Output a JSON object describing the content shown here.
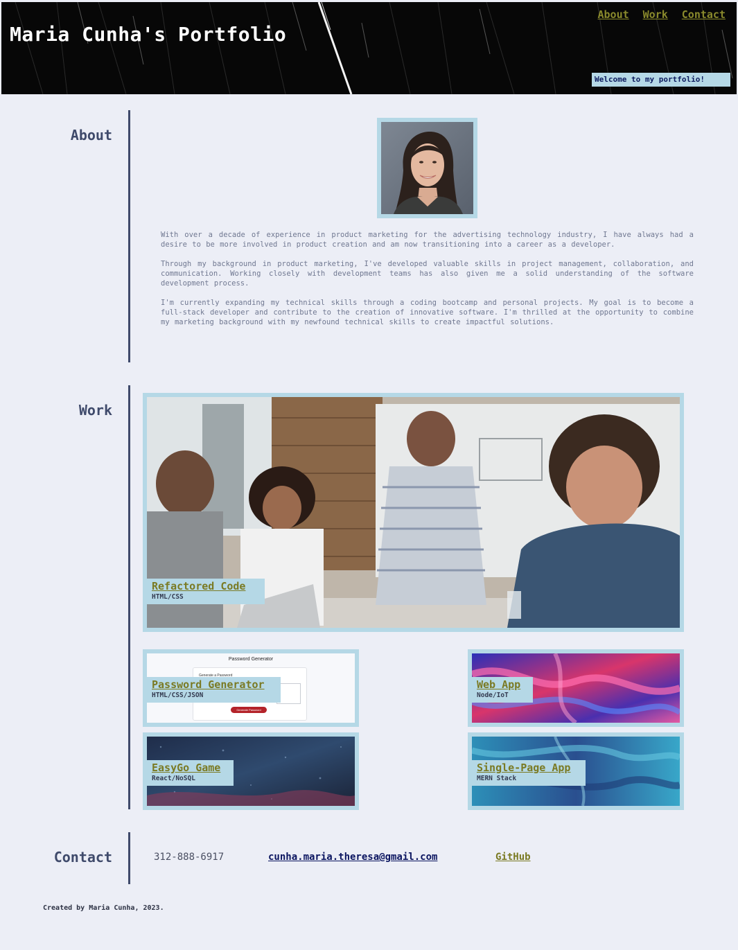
{
  "header": {
    "title": "Maria Cunha's Portfolio",
    "welcome": "Welcome to my portfolio!"
  },
  "nav": {
    "items": [
      {
        "label": "About"
      },
      {
        "label": "Work"
      },
      {
        "label": "Contact"
      }
    ]
  },
  "about": {
    "heading": "About",
    "paragraphs": [
      "With over a decade of experience in product marketing for the advertising technology industry, I have always had a desire to be more involved in product creation and am now transitioning into a career as a developer.",
      "Through my background in product marketing, I've developed valuable skills in project management, collaboration, and communication. Working closely with development teams has also given me a solid understanding of the software development process.",
      "I'm currently expanding my technical skills through a coding bootcamp and personal projects. My goal is to become a full-stack developer and contribute to the creation of innovative software. I'm thrilled at the opportunity to combine my marketing background with my newfound technical skills to create impactful solutions."
    ]
  },
  "work": {
    "heading": "Work",
    "projects": [
      {
        "name": "Refactored Code",
        "tech": "HTML/CSS"
      },
      {
        "name": "Password Generator",
        "tech": "HTML/CSS/JSON",
        "screenshot_title": "Password Generator",
        "screenshot_subtitle": "Generate a Password",
        "screenshot_button": "Generate Password"
      },
      {
        "name": "Web App",
        "tech": "Node/IoT"
      },
      {
        "name": "EasyGo Game",
        "tech": "React/NoSQL"
      },
      {
        "name": "Single-Page App",
        "tech": "MERN Stack"
      }
    ]
  },
  "contact": {
    "heading": "Contact",
    "phone": "312-888-6917",
    "email": "cunha.maria.theresa@gmail.com",
    "github": "GitHub"
  },
  "footer": {
    "text": "Created by Maria Cunha, 2023."
  },
  "colors": {
    "accent": "#b5d8e6",
    "heading": "#3f4a6b",
    "link": "#7a7a23",
    "background": "#eceef6"
  }
}
